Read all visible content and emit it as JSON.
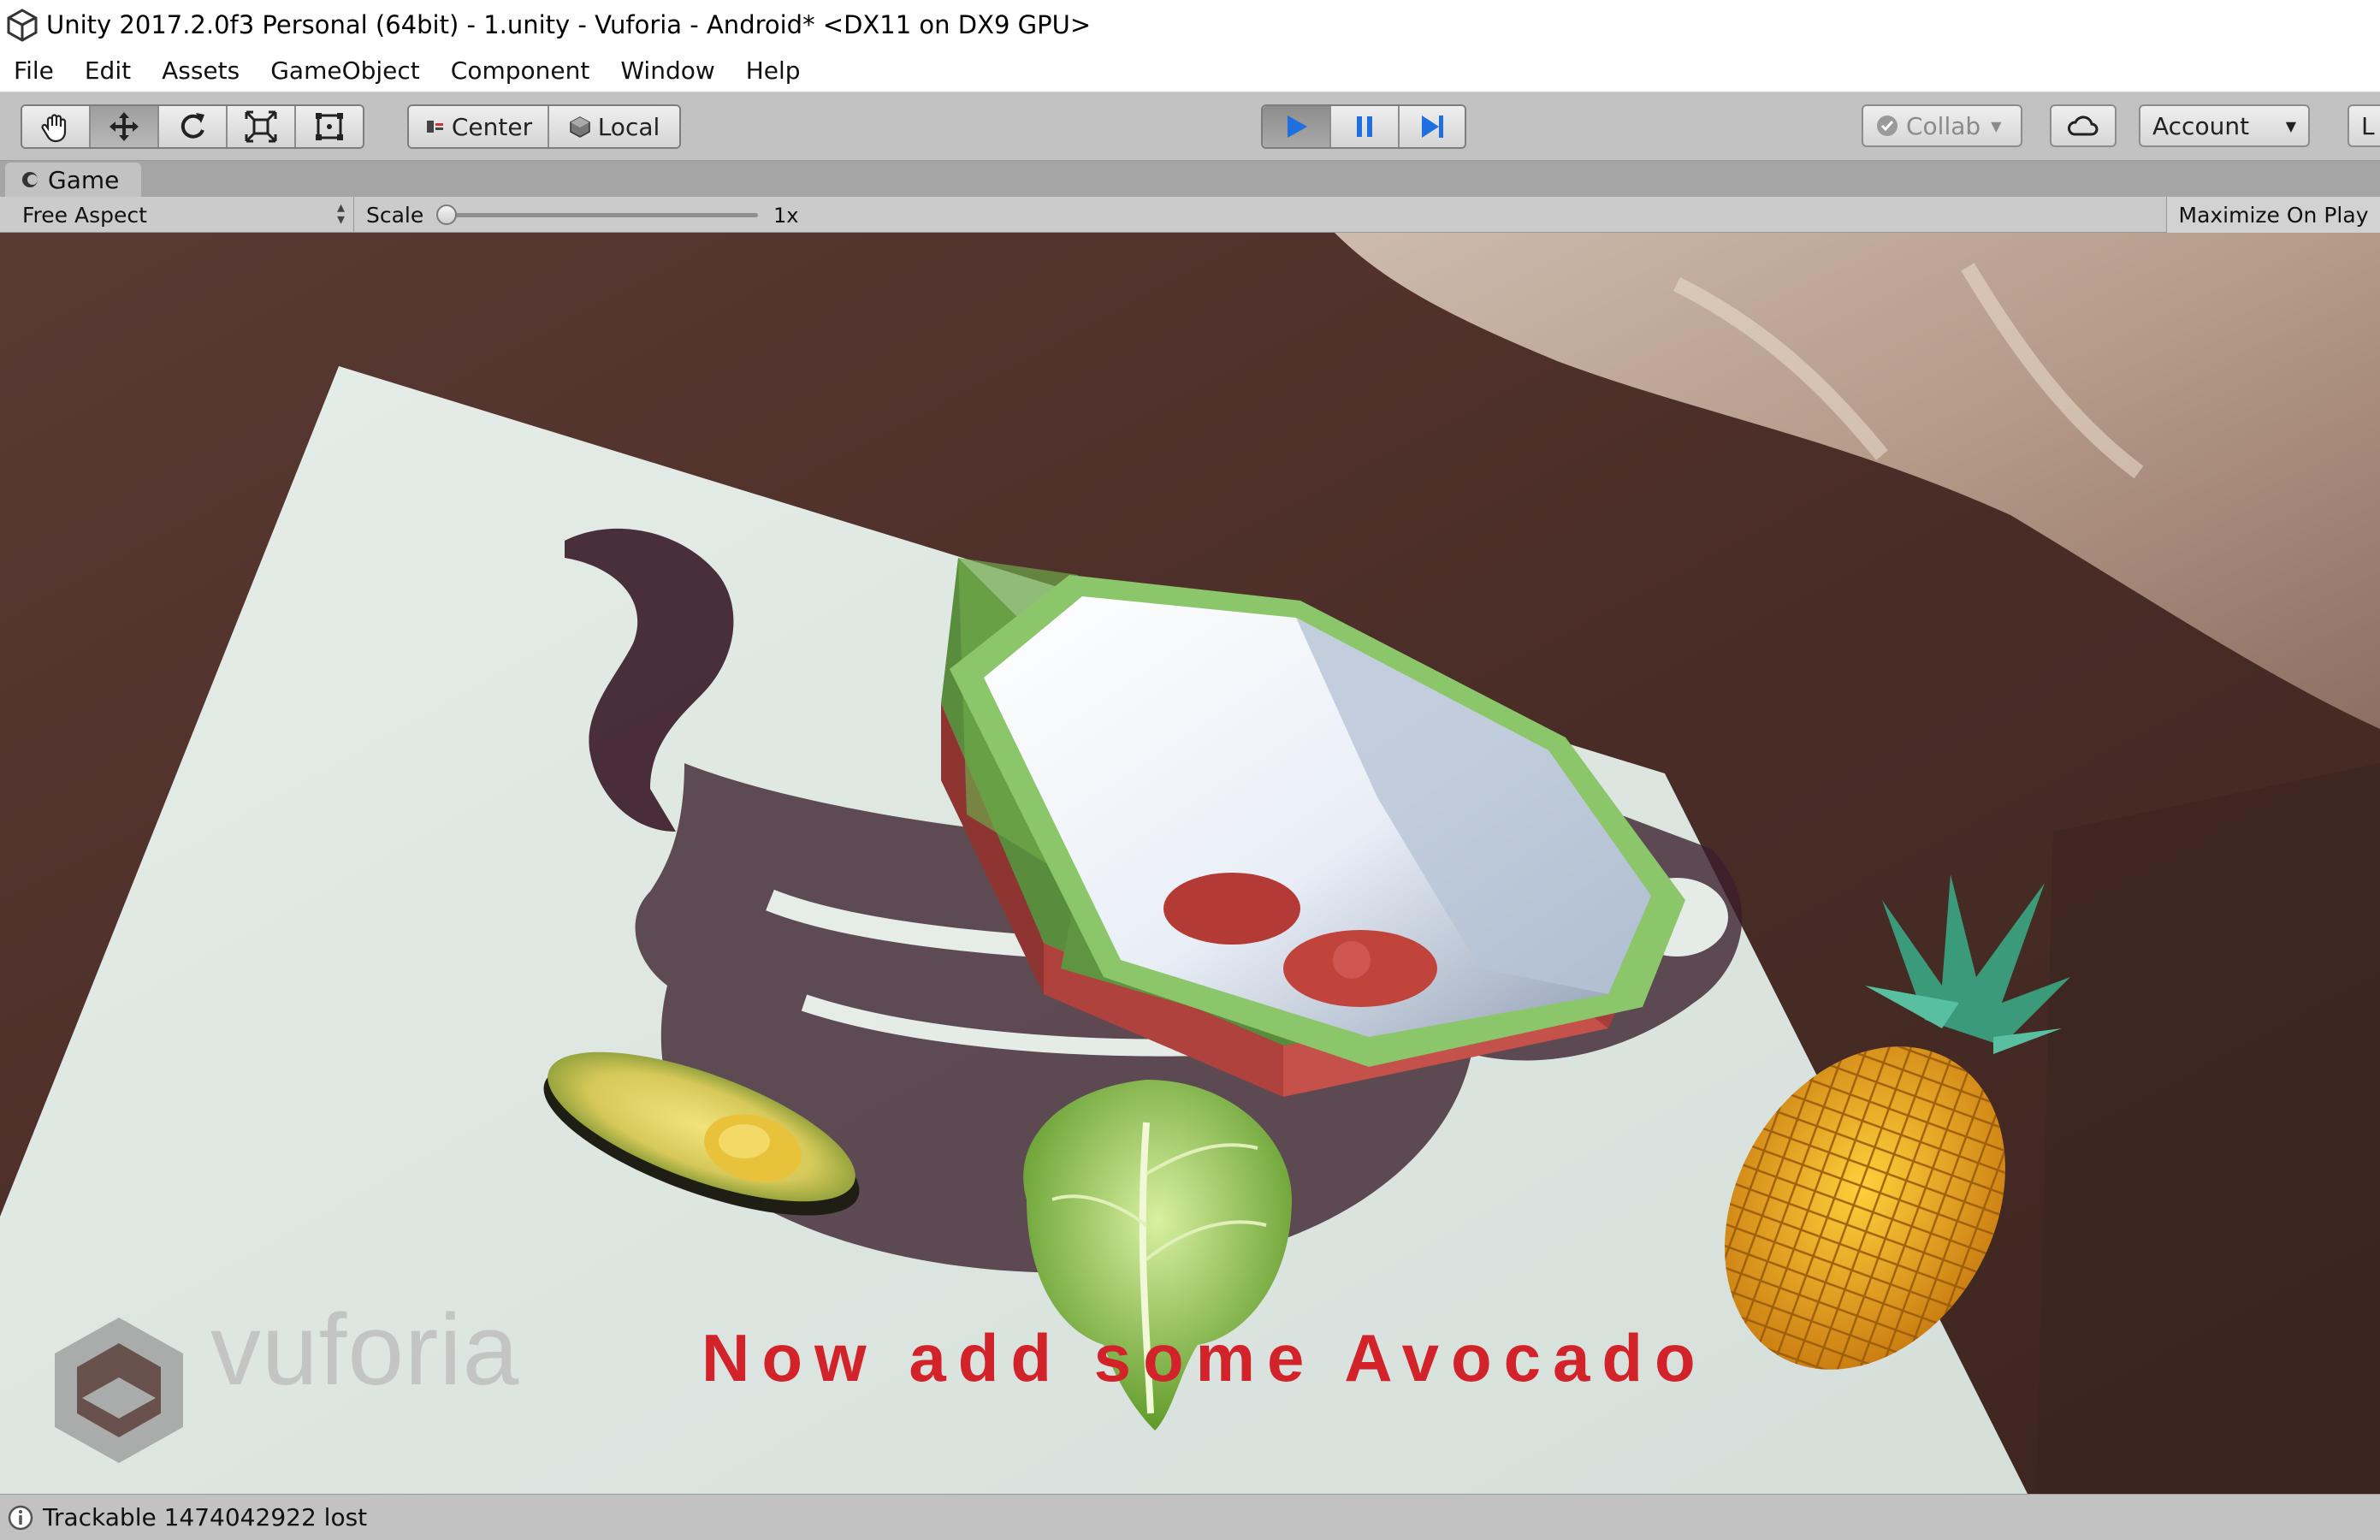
{
  "window": {
    "title": "Unity 2017.2.0f3 Personal (64bit) - 1.unity - Vuforia - Android* <DX11 on DX9 GPU>"
  },
  "menu": [
    "File",
    "Edit",
    "Assets",
    "GameObject",
    "Component",
    "Window",
    "Help"
  ],
  "toolbar": {
    "transform_tools": [
      "hand-icon",
      "move-icon",
      "rotate-icon",
      "scale-icon",
      "rect-icon"
    ],
    "pivot_label": "Center",
    "space_label": "Local",
    "play_controls": [
      "play-icon",
      "pause-icon",
      "step-icon"
    ],
    "collab_label": "Collab",
    "account_label": "Account",
    "layers_label": "L"
  },
  "game_view": {
    "tab_label": "Game",
    "aspect_label": "Free Aspect",
    "scale_label": "Scale",
    "scale_value": "1x",
    "maximize_label": "Maximize On Play",
    "overlay_text": "Now add some Avocado",
    "watermark": "vuforia"
  },
  "status": {
    "message": "Trackable 1474042922 lost"
  },
  "colors": {
    "overlay_text": "#d3232a",
    "bowl_green": "#8cc66a",
    "bowl_red": "#b2413c",
    "play_blue": "#1f6fe0"
  }
}
